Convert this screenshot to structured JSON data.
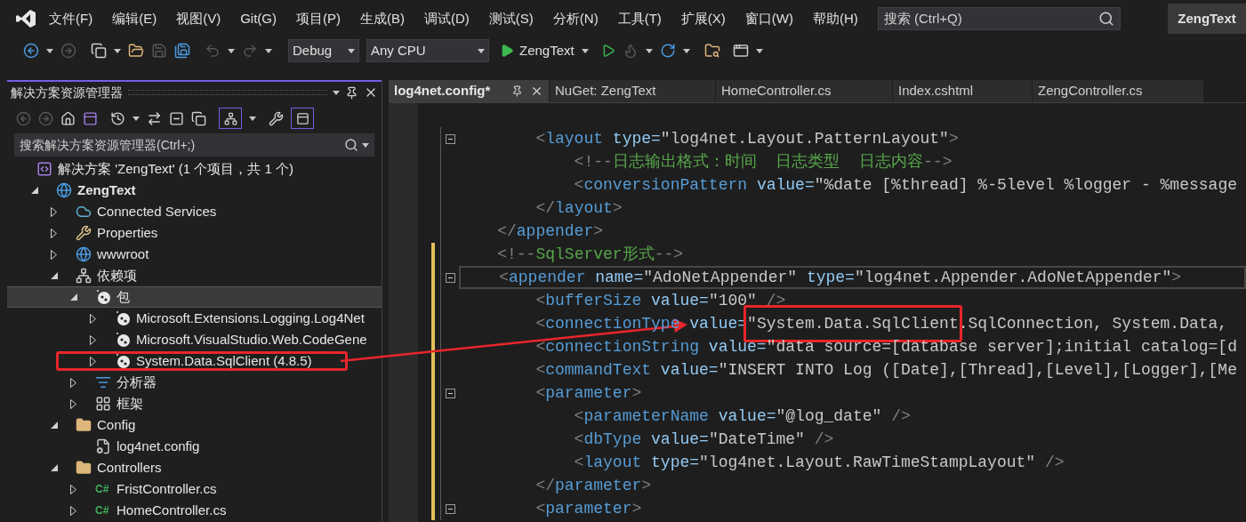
{
  "menu": [
    "文件(F)",
    "编辑(E)",
    "视图(V)",
    "Git(G)",
    "项目(P)",
    "生成(B)",
    "调试(D)",
    "测试(S)",
    "分析(N)",
    "工具(T)",
    "扩展(X)",
    "窗口(W)",
    "帮助(H)"
  ],
  "search": {
    "placeholder": "搜索 (Ctrl+Q)"
  },
  "title": "ZengText",
  "toolbar": {
    "configuration": "Debug",
    "platform": "Any CPU",
    "start_target": "ZengText"
  },
  "solution_explorer": {
    "title": "解决方案资源管理器",
    "search": {
      "placeholder": "搜索解决方案资源管理器(Ctrl+;)"
    },
    "tree": [
      {
        "label": "解决方案 'ZengText' (1 个项目，共 1 个)",
        "kind": "solution",
        "selected": false,
        "children": [
          {
            "label": "ZengText",
            "kind": "project",
            "expanded": true,
            "selected": false,
            "children": [
              {
                "label": "Connected Services",
                "kind": "cloud",
                "expanded": false,
                "selected": false
              },
              {
                "label": "Properties",
                "kind": "properties",
                "expanded": false,
                "selected": false
              },
              {
                "label": "wwwroot",
                "kind": "globe",
                "expanded": false,
                "selected": false
              },
              {
                "label": "依赖项",
                "kind": "dependencies",
                "expanded": true,
                "selected": false,
                "children": [
                  {
                    "label": "包",
                    "kind": "package",
                    "expanded": true,
                    "selected": true,
                    "children": [
                      {
                        "label": "Microsoft.Extensions.Logging.Log4Net",
                        "kind": "package",
                        "expanded": false,
                        "selected": false
                      },
                      {
                        "label": "Microsoft.VisualStudio.Web.CodeGene",
                        "kind": "package",
                        "expanded": false,
                        "selected": false
                      },
                      {
                        "label": "System.Data.SqlClient (4.8.5)",
                        "kind": "package",
                        "expanded": false,
                        "selected": false,
                        "highlighted": true
                      }
                    ]
                  },
                  {
                    "label": "分析器",
                    "kind": "analyzer",
                    "expanded": false,
                    "selected": false
                  },
                  {
                    "label": "框架",
                    "kind": "framework",
                    "expanded": false,
                    "selected": false
                  }
                ]
              },
              {
                "label": "Config",
                "kind": "folder",
                "expanded": true,
                "selected": false,
                "children": [
                  {
                    "label": "log4net.config",
                    "kind": "config",
                    "selected": false
                  }
                ]
              },
              {
                "label": "Controllers",
                "kind": "folder",
                "expanded": true,
                "selected": false,
                "children": [
                  {
                    "label": "FristController.cs",
                    "kind": "csharp",
                    "badge": "C#",
                    "expanded": false,
                    "selected": false
                  },
                  {
                    "label": "HomeController.cs",
                    "kind": "csharp",
                    "badge": "C#",
                    "expanded": false,
                    "selected": false
                  }
                ]
              }
            ]
          }
        ]
      }
    ]
  },
  "editor_tabs": [
    {
      "label": "log4net.config*",
      "selected": true
    },
    {
      "label": "NuGet: ZengText",
      "selected": false
    },
    {
      "label": "HomeController.cs",
      "selected": false
    },
    {
      "label": "Index.cshtml",
      "selected": false
    },
    {
      "label": "ZengController.cs",
      "selected": false
    }
  ],
  "code_lines": [
    {
      "foldable": true,
      "changed": false,
      "current": false,
      "tokens": [
        {
          "kind": "punct",
          "text": "        <"
        },
        {
          "kind": "tag",
          "text": "layout"
        },
        {
          "kind": "attr",
          "text": " type="
        },
        {
          "kind": "value",
          "text": "\"log4net.Layout.PatternLayout\""
        },
        {
          "kind": "punct",
          "text": ">"
        }
      ]
    },
    {
      "foldable": false,
      "changed": false,
      "current": false,
      "tokens": [
        {
          "kind": "punct",
          "text": "            <!--"
        },
        {
          "kind": "comment",
          "text": "日志输出格式：时间  日志类型  日志内容"
        },
        {
          "kind": "punct",
          "text": "-->"
        }
      ]
    },
    {
      "foldable": false,
      "changed": false,
      "current": false,
      "tokens": [
        {
          "kind": "punct",
          "text": "            <"
        },
        {
          "kind": "tag",
          "text": "conversionPattern"
        },
        {
          "kind": "attr",
          "text": " value="
        },
        {
          "kind": "value",
          "text": "\"%date [%thread] %-5level %logger - %message"
        }
      ]
    },
    {
      "foldable": false,
      "changed": false,
      "current": false,
      "tokens": [
        {
          "kind": "punct",
          "text": "        </"
        },
        {
          "kind": "tag",
          "text": "layout"
        },
        {
          "kind": "punct",
          "text": ">"
        }
      ]
    },
    {
      "foldable": false,
      "changed": false,
      "current": false,
      "tokens": [
        {
          "kind": "punct",
          "text": "    </"
        },
        {
          "kind": "tag",
          "text": "appender"
        },
        {
          "kind": "punct",
          "text": ">"
        }
      ]
    },
    {
      "foldable": false,
      "changed": true,
      "current": false,
      "tokens": [
        {
          "kind": "punct",
          "text": "    <!--"
        },
        {
          "kind": "comment",
          "text": "SqlServer形式"
        },
        {
          "kind": "punct",
          "text": "-->"
        }
      ]
    },
    {
      "foldable": true,
      "changed": true,
      "current": true,
      "tokens": [
        {
          "kind": "punct",
          "text": "    <"
        },
        {
          "kind": "tag",
          "text": "appender"
        },
        {
          "kind": "attr",
          "text": " name="
        },
        {
          "kind": "value",
          "text": "\"AdoNetAppender\""
        },
        {
          "kind": "attr",
          "text": " type="
        },
        {
          "kind": "value",
          "text": "\"log4net.Appender.AdoNetAppender\""
        },
        {
          "kind": "punct",
          "text": ">"
        }
      ]
    },
    {
      "foldable": false,
      "changed": true,
      "current": false,
      "tokens": [
        {
          "kind": "punct",
          "text": "        <"
        },
        {
          "kind": "tag",
          "text": "bufferSize"
        },
        {
          "kind": "attr",
          "text": " value="
        },
        {
          "kind": "value",
          "text": "\"100\""
        },
        {
          "kind": "punct",
          "text": " />"
        }
      ]
    },
    {
      "foldable": false,
      "changed": true,
      "current": false,
      "tokens": [
        {
          "kind": "punct",
          "text": "        <"
        },
        {
          "kind": "tag",
          "text": "connectionType"
        },
        {
          "kind": "attr",
          "text": " value="
        },
        {
          "kind": "value",
          "text": "\"System.Data.SqlClient",
          "highlighted": true
        },
        {
          "kind": "value",
          "text": ".SqlConnection, System.Data,"
        }
      ]
    },
    {
      "foldable": false,
      "changed": true,
      "current": false,
      "tokens": [
        {
          "kind": "punct",
          "text": "        <"
        },
        {
          "kind": "tag",
          "text": "connectionString"
        },
        {
          "kind": "attr",
          "text": " value="
        },
        {
          "kind": "value",
          "text": "\"data source=[database server];initial catalog=[d"
        }
      ]
    },
    {
      "foldable": false,
      "changed": true,
      "current": false,
      "tokens": [
        {
          "kind": "punct",
          "text": "        <"
        },
        {
          "kind": "tag",
          "text": "commandText"
        },
        {
          "kind": "attr",
          "text": " value="
        },
        {
          "kind": "value",
          "text": "\"INSERT INTO Log ([Date],[Thread],[Level],[Logger],[Me"
        }
      ]
    },
    {
      "foldable": true,
      "changed": true,
      "current": false,
      "tokens": [
        {
          "kind": "punct",
          "text": "        <"
        },
        {
          "kind": "tag",
          "text": "parameter"
        },
        {
          "kind": "punct",
          "text": ">"
        }
      ]
    },
    {
      "foldable": false,
      "changed": true,
      "current": false,
      "tokens": [
        {
          "kind": "punct",
          "text": "            <"
        },
        {
          "kind": "tag",
          "text": "parameterName"
        },
        {
          "kind": "attr",
          "text": " value="
        },
        {
          "kind": "value",
          "text": "\"@log_date\""
        },
        {
          "kind": "punct",
          "text": " />"
        }
      ]
    },
    {
      "foldable": false,
      "changed": true,
      "current": false,
      "tokens": [
        {
          "kind": "punct",
          "text": "            <"
        },
        {
          "kind": "tag",
          "text": "dbType"
        },
        {
          "kind": "attr",
          "text": " value="
        },
        {
          "kind": "value",
          "text": "\"DateTime\""
        },
        {
          "kind": "punct",
          "text": " />"
        }
      ]
    },
    {
      "foldable": false,
      "changed": true,
      "current": false,
      "tokens": [
        {
          "kind": "punct",
          "text": "            <"
        },
        {
          "kind": "tag",
          "text": "layout"
        },
        {
          "kind": "attr",
          "text": " type="
        },
        {
          "kind": "value",
          "text": "\"log4net.Layout.RawTimeStampLayout\""
        },
        {
          "kind": "punct",
          "text": " />"
        }
      ]
    },
    {
      "foldable": false,
      "changed": true,
      "current": false,
      "tokens": [
        {
          "kind": "punct",
          "text": "        </"
        },
        {
          "kind": "tag",
          "text": "parameter"
        },
        {
          "kind": "punct",
          "text": ">"
        }
      ]
    },
    {
      "foldable": true,
      "changed": true,
      "current": false,
      "tokens": [
        {
          "kind": "punct",
          "text": "        <"
        },
        {
          "kind": "tag",
          "text": "parameter"
        },
        {
          "kind": "punct",
          "text": ">"
        }
      ]
    }
  ]
}
